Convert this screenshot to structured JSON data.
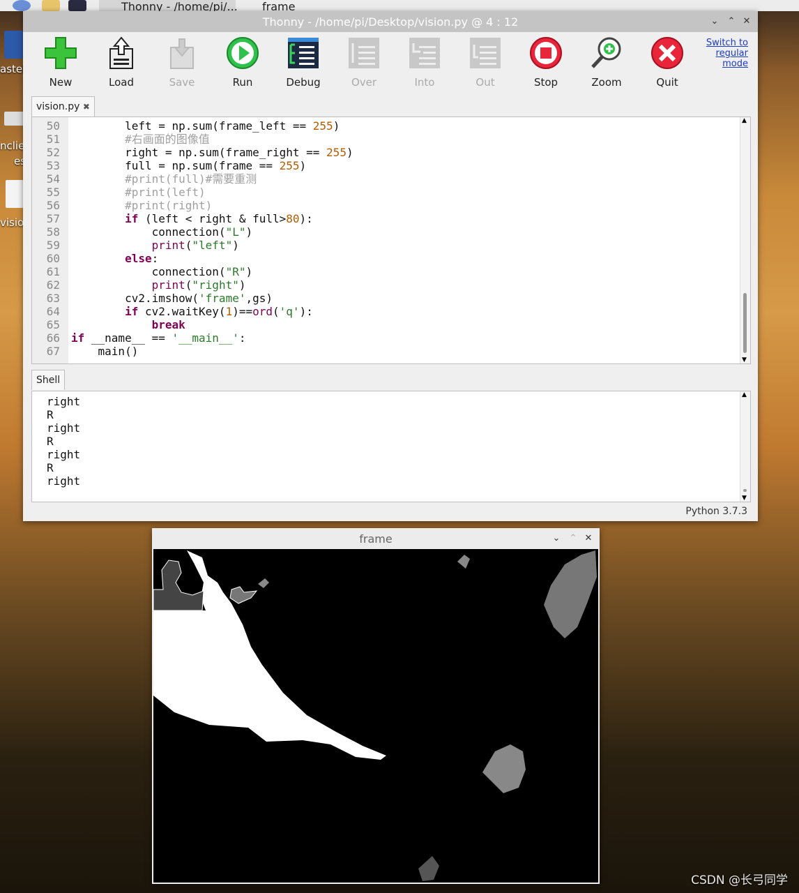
{
  "taskbar": {
    "items": [
      "Thonny  -  /home/pi/...",
      "frame"
    ]
  },
  "desktop": {
    "labels": [
      "asteb",
      "nclie",
      "es",
      "visior"
    ]
  },
  "thonny": {
    "title": "Thonny  -  /home/pi/Desktop/vision.py  @  4 : 12",
    "toolbar": {
      "new": "New",
      "load": "Load",
      "save": "Save",
      "run": "Run",
      "debug": "Debug",
      "over": "Over",
      "into": "Into",
      "out": "Out",
      "stop": "Stop",
      "zoom": "Zoom",
      "quit": "Quit",
      "switch_mode_line1": "Switch to",
      "switch_mode_line2": "regular",
      "switch_mode_line3": "mode"
    },
    "editor_tab": "vision.py",
    "editor_tab_close": "✖",
    "code_lines": [
      {
        "n": "50",
        "text": "        left = np.sum(frame_left == 255)"
      },
      {
        "n": "51",
        "text": "        #右画面的图像值"
      },
      {
        "n": "52",
        "text": "        right = np.sum(frame_right == 255)"
      },
      {
        "n": "53",
        "text": "        full = np.sum(frame == 255)"
      },
      {
        "n": "54",
        "text": "        #print(full)#需要重测"
      },
      {
        "n": "55",
        "text": "        #print(left)"
      },
      {
        "n": "56",
        "text": "        #print(right)"
      },
      {
        "n": "57",
        "text": "        if (left < right & full>80):"
      },
      {
        "n": "58",
        "text": "            connection(\"L\")"
      },
      {
        "n": "59",
        "text": "            print(\"left\")"
      },
      {
        "n": "60",
        "text": "        else:"
      },
      {
        "n": "61",
        "text": "            connection(\"R\")"
      },
      {
        "n": "62",
        "text": "            print(\"right\")"
      },
      {
        "n": "63",
        "text": "        cv2.imshow('frame',gs)"
      },
      {
        "n": "64",
        "text": "        if cv2.waitKey(1)==ord('q'):"
      },
      {
        "n": "65",
        "text": "            break"
      },
      {
        "n": "66",
        "text": "if __name__ == '__main__':"
      },
      {
        "n": "67",
        "text": "    main()"
      }
    ],
    "shell_tab": "Shell",
    "shell_lines": [
      "right",
      "R",
      "right",
      "R",
      "right",
      "R",
      "right"
    ],
    "status": "Python 3.7.3"
  },
  "frame_window": {
    "title": "frame"
  },
  "watermark": "CSDN @长弓同学",
  "colors": {
    "keyword": "#7f0055",
    "number": "#b35c00",
    "string": "#2a7a2a",
    "comment": "#a0a0a0"
  }
}
